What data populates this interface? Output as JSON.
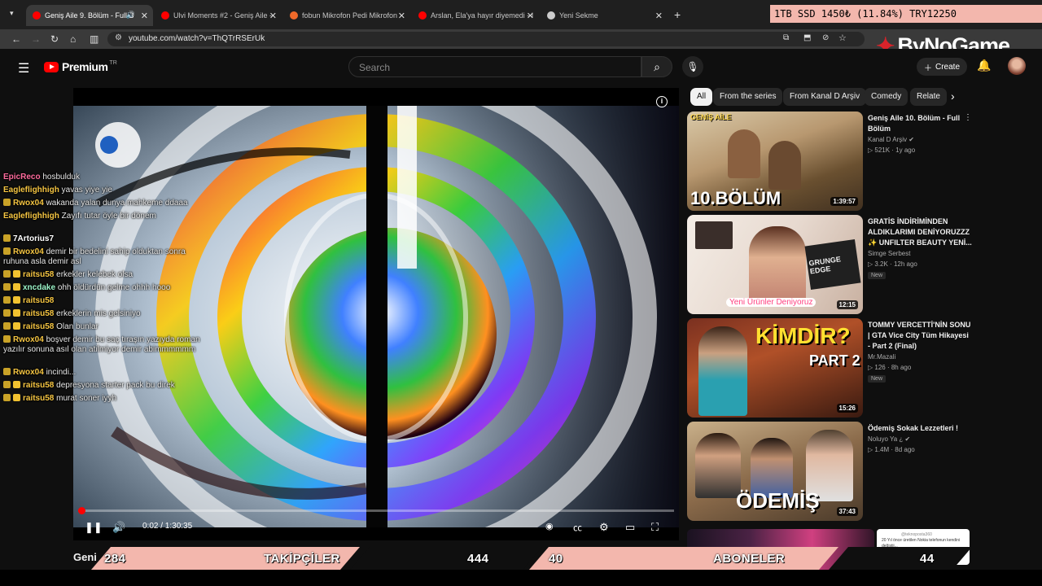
{
  "browser": {
    "tabs": [
      {
        "label": "Geniş Aile 9. Bölüm - Full B",
        "active": true,
        "favicon_color": "#ff0000"
      },
      {
        "label": "Ulvi Moments #2 - Geniş Aile -",
        "active": false,
        "favicon_color": "#ff0000"
      },
      {
        "label": "fobun Mikrofon Pedi Mikrofon",
        "active": false,
        "favicon_color": "#f06a2a"
      },
      {
        "label": "Arslan, Ela'ya hayır diyemedi - I",
        "active": false,
        "favicon_color": "#ff0000"
      },
      {
        "label": "Yeni Sekme",
        "active": false,
        "favicon_color": "#cccccc"
      }
    ],
    "url": "youtube.com/watch?v=ThQTrRSErUk"
  },
  "overlay": {
    "ticker": "1TB SSD        1450₺ (11.84%)        TRY12250",
    "brand": "ByNoGame",
    "stats": {
      "left_value": "284",
      "left_label": "TAKİPÇİLER",
      "center_value": "444",
      "right_value": "40",
      "right_label": "ABONELER",
      "far_right_value": "44"
    }
  },
  "youtube": {
    "logo": "Premium",
    "logo_sup": "TR",
    "search_placeholder": "Search",
    "create_label": "Create",
    "chips": [
      "All",
      "From the series",
      "From Kanal D Arşiv",
      "Comedy",
      "Relate"
    ],
    "video_title_peek": "Geni",
    "player": {
      "current_time": "0:02",
      "duration": "1:30:35",
      "time_text": "0:02 / 1:30:35",
      "progress": 0.001
    },
    "recommendations": [
      {
        "title": "Geniş Aile 10. Bölüm - Full Bölüm",
        "channel": "Kanal D Arşiv",
        "verified": true,
        "meta": "521K · 1y ago",
        "duration": "1:39:57",
        "badge": "",
        "thumb_text": "10.BÖLÜM",
        "thumb_tag": "GENİŞ AİLE"
      },
      {
        "title": "GRATİS İNDİRİMİNDEN ALDIKLARIMI DENİYORUZZZ ✨ UNFILTER BEAUTY YENİ...",
        "channel": "Simge Serbest",
        "verified": false,
        "meta": "3.2K · 12h ago",
        "duration": "12:15",
        "badge": "New",
        "thumb_text": "Yeni Ürünler Deniyoruz",
        "thumb_tag": "GRUNGE EDGE"
      },
      {
        "title": "TOMMY VERCETTİ'NİN SONU | GTA Vice City Tüm Hikayesi - Part 2 (Final)",
        "channel": "Mr.Mazali",
        "verified": false,
        "meta": "126 · 8h ago",
        "duration": "15:26",
        "badge": "New",
        "thumb_text": "KİMDİR?",
        "thumb_tag": "PART 2"
      },
      {
        "title": "Ödemiş Sokak Lezzetleri !",
        "channel": "Noluyo Ya ¿",
        "verified": true,
        "meta": "1.4M · 8d ago",
        "duration": "37:43",
        "badge": "",
        "thumb_text": "ÖDEMİŞ",
        "thumb_tag": ""
      }
    ],
    "bottom_card_text": "20 Yıl önce üretilen Nokia telefonun kendini değiştii..."
  },
  "chat": {
    "messages": [
      {
        "user": "EpicReco",
        "text": "hosbulduk",
        "color": "#ff6b9d",
        "badges": 0
      },
      {
        "user": "Eagleflighhigh",
        "text": "yavas yiye yie",
        "color": "#f5c542",
        "badges": 0
      },
      {
        "user": "Rwox04",
        "text": "wakanda yalan dunya mahkeme ddaaa",
        "color": "#f5c542",
        "badges": 1
      },
      {
        "user": "Eagleflighhigh",
        "text": "Zayıfı tutar öyle bir dönem",
        "color": "#f5c542",
        "badges": 0
      },
      {
        "user": "7Artorius7",
        "text": "",
        "color": "#ffffff",
        "badges": 1
      },
      {
        "user": "Rwox04",
        "text": "demir bir bedelini sahip olduktan sonra ruhuna asla demir asl",
        "color": "#f5c542",
        "badges": 1
      },
      {
        "user": "raitsu58",
        "text": "erkekler kelebek olsa",
        "color": "#f5c542",
        "badges": 2
      },
      {
        "user": "xncdake",
        "text": "ohh öldürdün gelme ohhh hooo",
        "color": "#9cf5c9",
        "badges": 2
      },
      {
        "user": "raitsu58",
        "text": "",
        "color": "#f5c542",
        "badges": 2
      },
      {
        "user": "raitsu58",
        "text": "erkeklerin mis gelsiniyo",
        "color": "#f5c542",
        "badges": 2
      },
      {
        "user": "raitsu58",
        "text": "Olan bunlar",
        "color": "#f5c542",
        "badges": 2
      },
      {
        "user": "Rwox04",
        "text": "boşver demir bu saç tıraşın yazıyda roman yazılır sonuna asıl olan atilmiyor demir abimmmmmm",
        "color": "#f5c542",
        "badges": 1
      },
      {
        "user": "Rwox04",
        "text": "incindi...",
        "color": "#f5c542",
        "badges": 1
      },
      {
        "user": "raitsu58",
        "text": "depresyona starter pack bu direk",
        "color": "#f5c542",
        "badges": 2
      },
      {
        "user": "raitsu58",
        "text": "murat soner iyyh",
        "color": "#f5c542",
        "badges": 2
      }
    ]
  },
  "colors": {
    "accent_red": "#ff0000",
    "overlay_pink": "#f3b7ad",
    "bg": "#0f0f0f"
  }
}
